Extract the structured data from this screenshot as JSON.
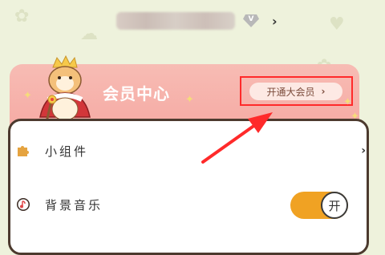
{
  "profile": {
    "vip_badge": "V",
    "chevron": "›"
  },
  "vip_banner": {
    "title": "会员中心",
    "open_button_label": "开通大会员",
    "open_button_chevron": "›"
  },
  "settings": {
    "items": [
      {
        "label": "小组件",
        "icon": "puzzle-icon",
        "chevron": "›"
      },
      {
        "label": "背景音乐",
        "icon": "music-note-icon",
        "toggle_text": "开",
        "toggle_on": true
      }
    ]
  },
  "colors": {
    "accent_red": "#ff2a2a",
    "toggle_orange": "#f0a223",
    "banner_pink": "#f6a7a1"
  }
}
